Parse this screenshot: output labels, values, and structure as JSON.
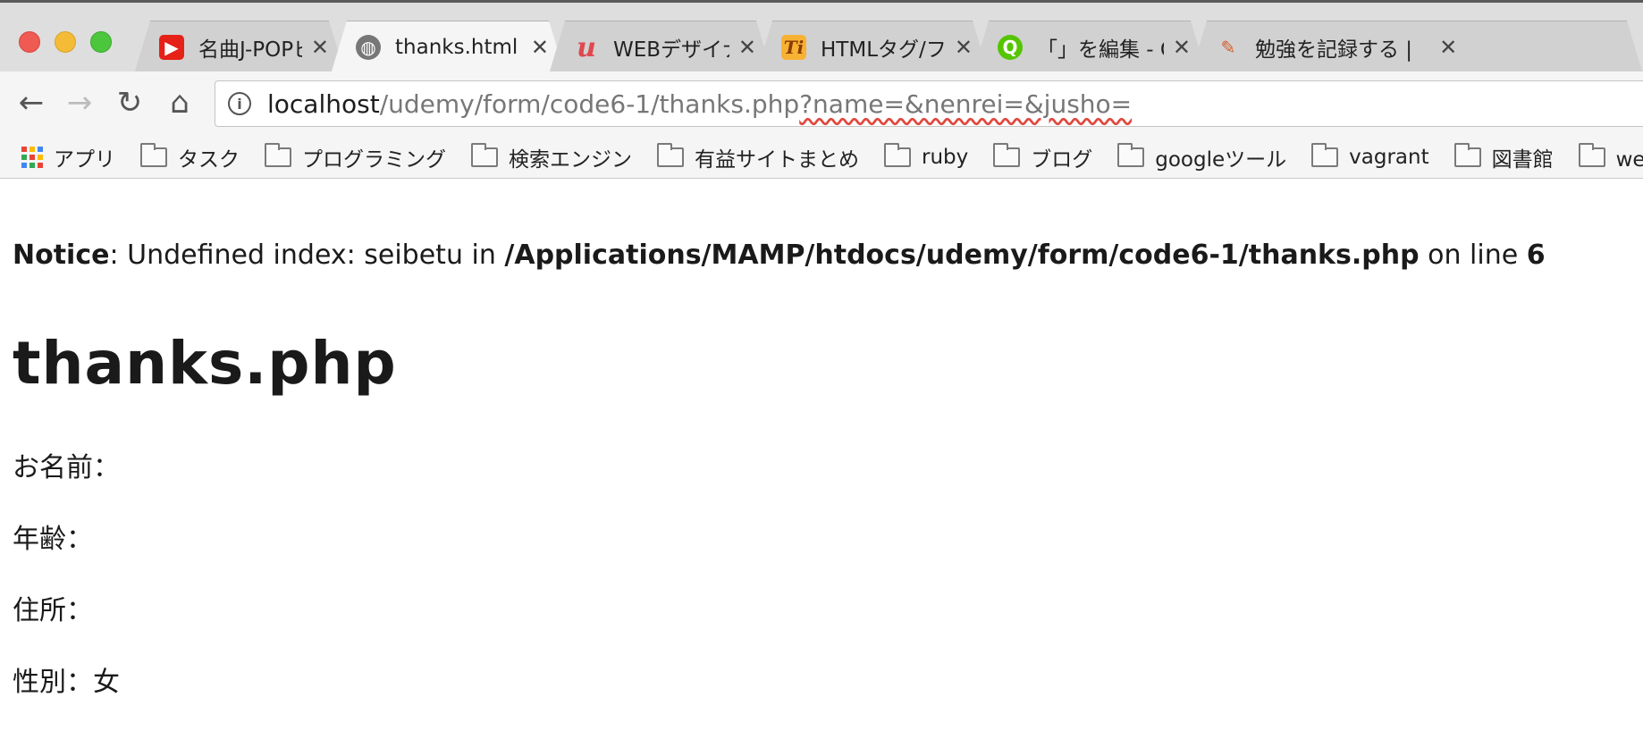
{
  "tabs": [
    {
      "label": "名曲J-POPピア",
      "favicon": "youtube-icon",
      "active": false
    },
    {
      "label": "thanks.html",
      "favicon": "globe-icon",
      "active": true
    },
    {
      "label": "WEBデザイナー",
      "favicon": "udemy-icon",
      "active": false
    },
    {
      "label": "HTMLタグ/フォ",
      "favicon": "ti-icon",
      "active": false
    },
    {
      "label": "「」を編集 - Qiit",
      "favicon": "qiita-icon",
      "active": false
    },
    {
      "label": "勉強を記録する |",
      "favicon": "study-icon",
      "active": false
    }
  ],
  "tab_close_glyph": "✕",
  "address": {
    "host": "localhost",
    "path": "/udemy/form/code6-1/thanks.php",
    "query": "?name=&nenrei=&jusho="
  },
  "bookmarks": {
    "apps_label": "アプリ",
    "folders": [
      "タスク",
      "プログラミング",
      "検索エンジン",
      "有益サイトまとめ",
      "ruby",
      "ブログ",
      "googleツール",
      "vagrant",
      "図書館",
      "web便利"
    ]
  },
  "page": {
    "notice_label": "Notice",
    "notice_message": ": Undefined index: seibetu in ",
    "notice_path": "/Applications/MAMP/htdocs/udemy/form/code6-1/thanks.php",
    "notice_on_line": " on line ",
    "notice_line": "6",
    "title": "thanks.php",
    "fields": [
      {
        "label": "お名前：",
        "value": ""
      },
      {
        "label": "年齢：",
        "value": ""
      },
      {
        "label": "住所：",
        "value": ""
      },
      {
        "label": "性別：",
        "value": "女"
      }
    ]
  },
  "colors": {
    "traffic_close": "#ef5a52",
    "traffic_minimize": "#f4bb37",
    "traffic_maximize": "#4cc63d",
    "spellcheck_underline": "#e0483e"
  }
}
